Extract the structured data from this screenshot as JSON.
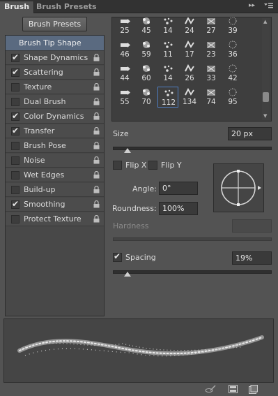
{
  "tabs": [
    {
      "label": "Brush",
      "active": true
    },
    {
      "label": "Brush Presets",
      "active": false
    }
  ],
  "panel_menu": {
    "collapse_icon": "double-chevron-right-icon",
    "menu_icon": "panel-menu-icon"
  },
  "brush_presets_button": "Brush Presets",
  "options": [
    {
      "label": "Brush Tip Shape",
      "selected": true,
      "checkable": false
    },
    {
      "label": "Shape Dynamics",
      "checked": true,
      "locked": true
    },
    {
      "label": "Scattering",
      "checked": true,
      "locked": true
    },
    {
      "label": "Texture",
      "checked": false,
      "locked": true
    },
    {
      "label": "Dual Brush",
      "checked": false,
      "locked": true
    },
    {
      "label": "Color Dynamics",
      "checked": true,
      "locked": true
    },
    {
      "label": "Transfer",
      "checked": true,
      "locked": true
    },
    {
      "label": "Brush Pose",
      "checked": false,
      "locked": true
    },
    {
      "label": "Noise",
      "checked": false,
      "locked": true
    },
    {
      "label": "Wet Edges",
      "checked": false,
      "locked": true
    },
    {
      "label": "Build-up",
      "checked": false,
      "locked": true
    },
    {
      "label": "Smoothing",
      "checked": true,
      "locked": true
    },
    {
      "label": "Protect Texture",
      "checked": false,
      "locked": true
    }
  ],
  "brush_tips": [
    [
      "25",
      "45",
      "14",
      "24",
      "27",
      "39"
    ],
    [
      "46",
      "59",
      "11",
      "17",
      "23",
      "36"
    ],
    [
      "44",
      "60",
      "14",
      "26",
      "33",
      "42"
    ],
    [
      "55",
      "70",
      "112",
      "134",
      "74",
      "95"
    ]
  ],
  "selected_tip": "112",
  "size": {
    "label": "Size",
    "value": "20 px",
    "slider_fraction": 0.09
  },
  "flip_x": {
    "label": "Flip X",
    "checked": false
  },
  "flip_y": {
    "label": "Flip Y",
    "checked": false
  },
  "angle": {
    "label": "Angle:",
    "value": "0°"
  },
  "roundness": {
    "label": "Roundness:",
    "value": "100%"
  },
  "hardness": {
    "label": "Hardness",
    "value": ""
  },
  "spacing": {
    "label": "Spacing",
    "checked": true,
    "value": "19%",
    "slider_fraction": 0.09
  },
  "bottom_icons": [
    "toggle-live-tip-icon",
    "grid-icon",
    "new-preset-icon"
  ]
}
